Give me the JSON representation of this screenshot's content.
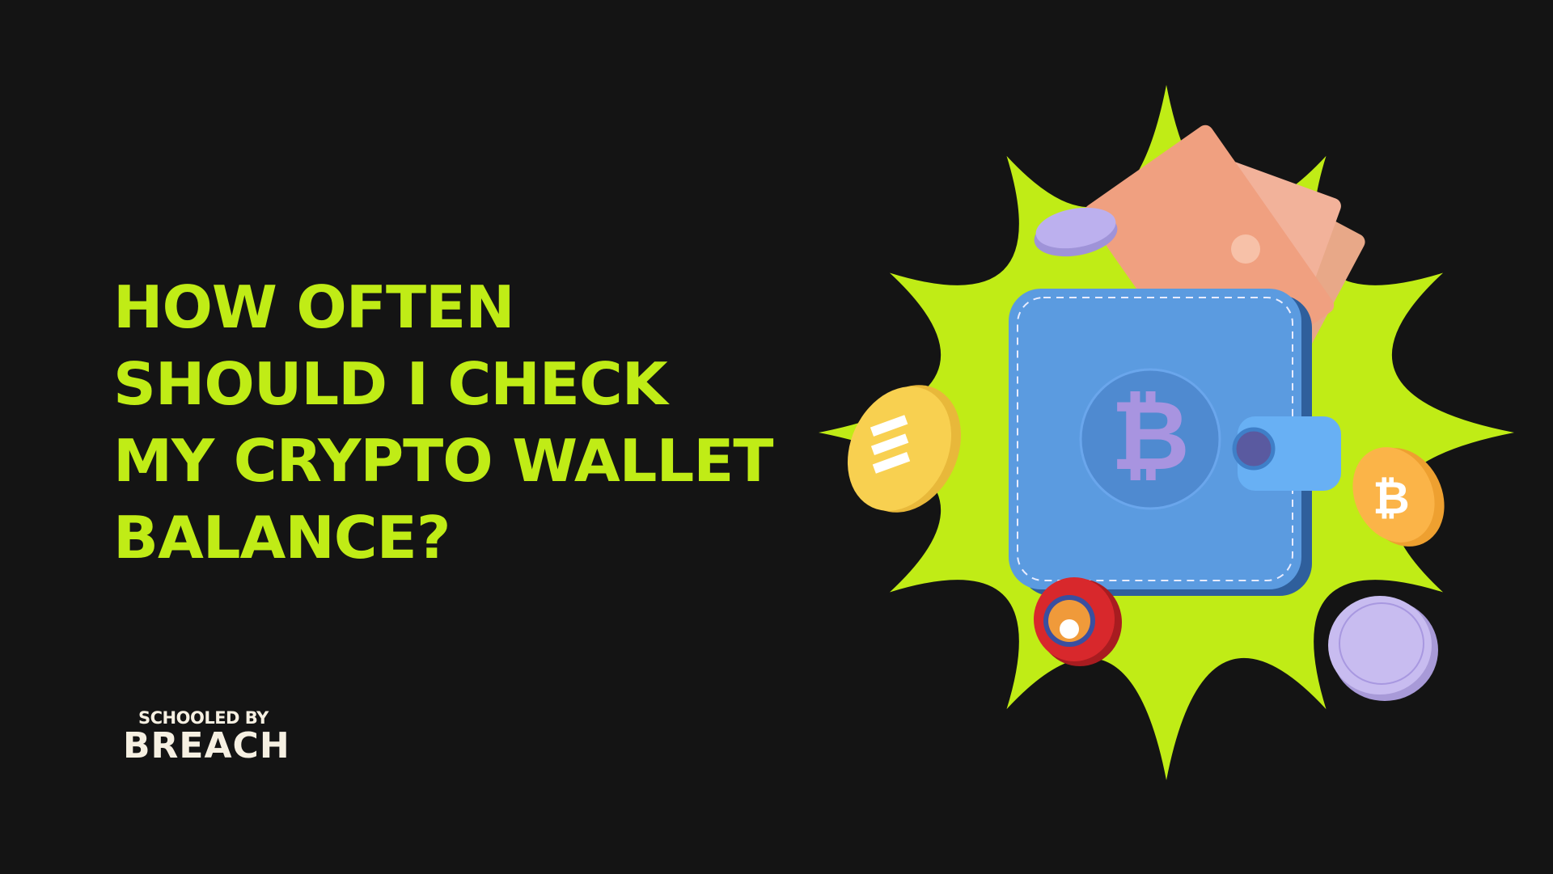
{
  "headline": {
    "lines": [
      "HOW OFTEN",
      "SHOULD I CHECK",
      "MY CRYPTO WALLET",
      "BALANCE?"
    ]
  },
  "logo": {
    "line1": "SCHOOLED BY",
    "line2": "BREACH"
  },
  "colors": {
    "background": "#141414",
    "accent": "#c0ec16",
    "logo_text": "#f6f0e2",
    "wallet": "#5b9be0",
    "bills": "#f0a080"
  },
  "illustration": {
    "icons": [
      "starburst",
      "wallet-icon",
      "bitcoin-icon",
      "cash-bills",
      "coin-gold",
      "coin-purple",
      "coin-bitcoin-orange",
      "coin-shiba-red",
      "coin-lavender"
    ]
  }
}
